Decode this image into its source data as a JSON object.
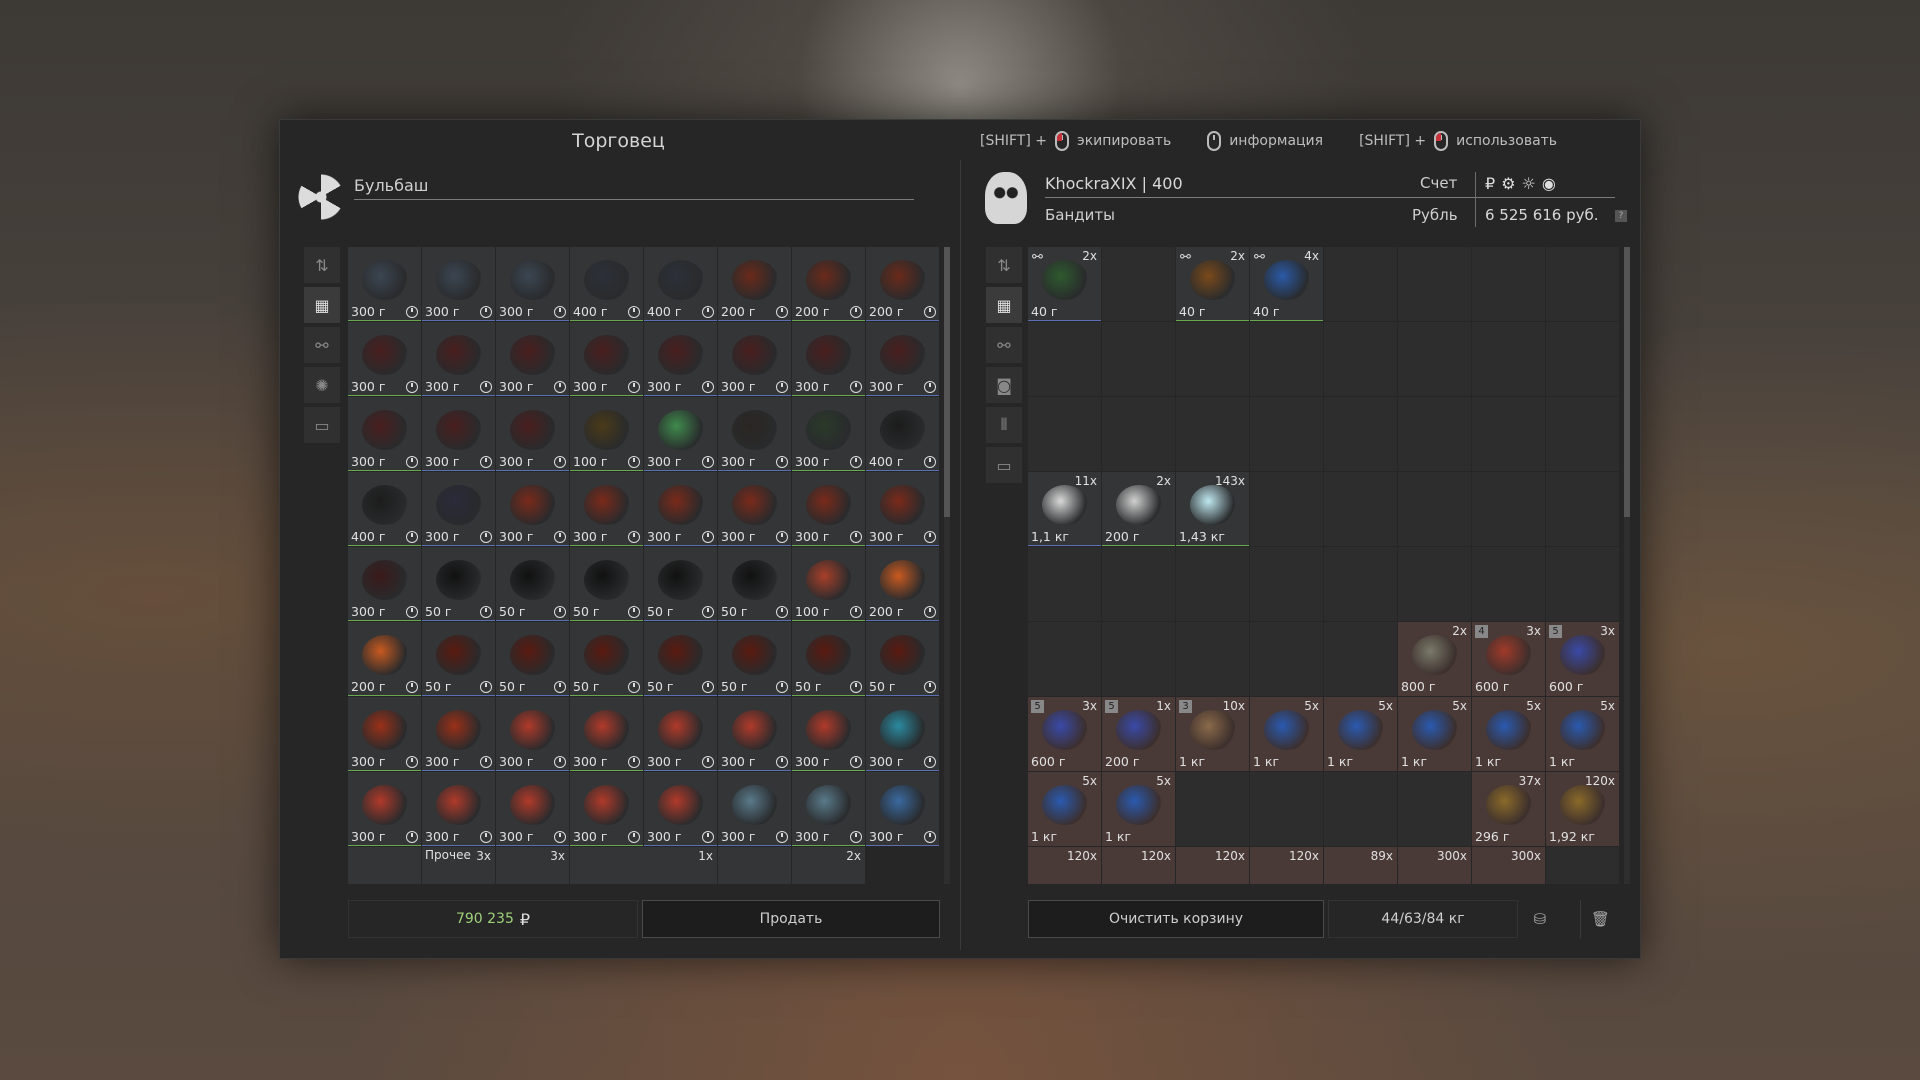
{
  "window": {
    "title": "Торговец"
  },
  "hints": [
    {
      "prefix": "[SHIFT] +",
      "label": "экипировать",
      "red": true
    },
    {
      "prefix": "",
      "label": "информация",
      "red": false
    },
    {
      "prefix": "[SHIFT] +",
      "label": "использовать",
      "red": true
    }
  ],
  "trader": {
    "name": "Бульбаш"
  },
  "player": {
    "name": "KhockraXIX",
    "level": "400",
    "faction": "Бандиты",
    "account_label": "Счет",
    "currency_label": "Рубль",
    "balance": "6 525 616 руб."
  },
  "trader_items": [
    [
      "300 г",
      "300 г",
      "300 г",
      "400 г",
      "400 г",
      "200 г",
      "200 г",
      "200 г"
    ],
    [
      "300 г",
      "300 г",
      "300 г",
      "300 г",
      "300 г",
      "300 г",
      "300 г",
      "300 г"
    ],
    [
      "300 г",
      "300 г",
      "300 г",
      "100 г",
      "300 г",
      "300 г",
      "300 г",
      "400 г"
    ],
    [
      "400 г",
      "300 г",
      "300 г",
      "300 г",
      "300 г",
      "300 г",
      "300 г",
      "300 г"
    ],
    [
      "300 г",
      "50 г",
      "50 г",
      "50 г",
      "50 г",
      "50 г",
      "100 г",
      "200 г"
    ],
    [
      "200 г",
      "50 г",
      "50 г",
      "50 г",
      "50 г",
      "50 г",
      "50 г",
      "50 г"
    ],
    [
      "300 г",
      "300 г",
      "300 г",
      "300 г",
      "300 г",
      "300 г",
      "300 г",
      "300 г"
    ],
    [
      "300 г",
      "300 г",
      "300 г",
      "300 г",
      "300 г",
      "300 г",
      "300 г",
      "300 г"
    ]
  ],
  "trader_partial": {
    "other_label": "Прочее",
    "q1": "3x",
    "q2": "3x",
    "q3": "1x",
    "q4": "2x"
  },
  "player_items": {
    "row0": [
      {
        "price": "40 г",
        "qty": "2x",
        "link": true
      },
      null,
      {
        "price": "40 г",
        "qty": "2x",
        "link": true
      },
      {
        "price": "40 г",
        "qty": "4x",
        "link": true
      }
    ],
    "row3": [
      {
        "price": "1,1 кг",
        "qty": "11x"
      },
      {
        "price": "200 г",
        "qty": "2x"
      },
      {
        "price": "1,43 кг",
        "qty": "143x"
      }
    ],
    "row5": [
      {
        "price": "800 г",
        "qty": "2x"
      },
      {
        "price": "600 г",
        "qty": "3x",
        "badge": "4"
      },
      {
        "price": "600 г",
        "qty": "3x",
        "badge": "5"
      }
    ],
    "row6": [
      {
        "price": "600 г",
        "qty": "3x",
        "badge": "5"
      },
      {
        "price": "200 г",
        "qty": "1x",
        "badge": "5"
      },
      {
        "price": "1 кг",
        "qty": "10x",
        "badge": "3"
      },
      {
        "price": "1 кг",
        "qty": "5x"
      },
      {
        "price": "1 кг",
        "qty": "5x"
      },
      {
        "price": "1 кг",
        "qty": "5x"
      },
      {
        "price": "1 кг",
        "qty": "5x"
      },
      {
        "price": "1 кг",
        "qty": "5x"
      }
    ],
    "row7": [
      {
        "price": "1 кг",
        "qty": "5x"
      },
      {
        "price": "1 кг",
        "qty": "5x"
      },
      {
        "price": "296 г",
        "qty": "37x"
      },
      {
        "price": "1,92 кг",
        "qty": "120x"
      }
    ],
    "row8": [
      "120x",
      "120x",
      "120x",
      "120x",
      "89x",
      "300x",
      "300x"
    ]
  },
  "bottom": {
    "sum": "790 235",
    "sum_currency": "₽",
    "sell": "Продать",
    "clear": "Очистить корзину",
    "weight": "44/63/84 кг"
  },
  "colors": {
    "sum": "#9fd27a",
    "underline_green": "#6aa84f",
    "underline_blue": "#5b6fb5"
  }
}
